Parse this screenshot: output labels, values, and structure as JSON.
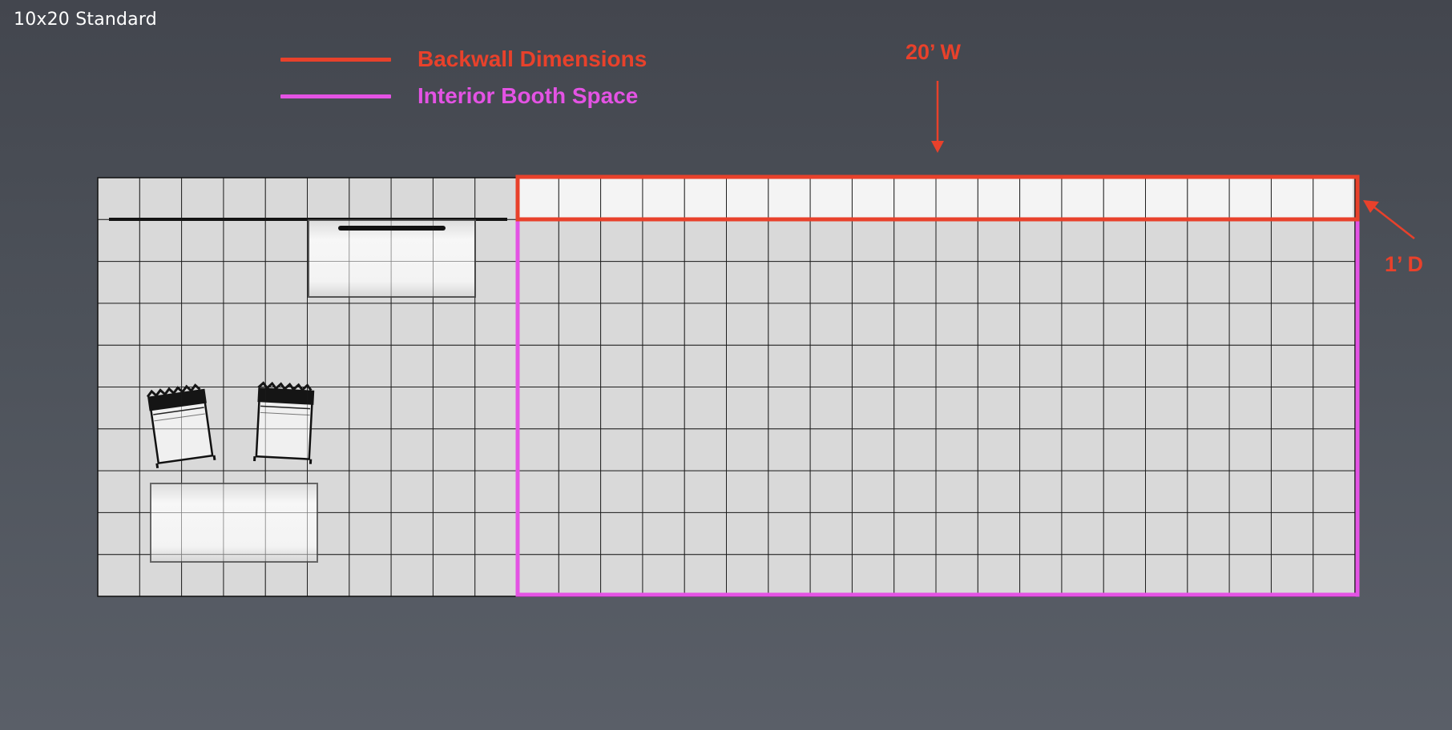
{
  "title": "10x20 Standard",
  "legend": {
    "backwall": {
      "label": "Backwall Dimensions",
      "color": "#e8412b"
    },
    "interior": {
      "label": "Interior Booth Space",
      "color": "#e453e4"
    }
  },
  "dimensions": {
    "width_label": "20’ W",
    "depth_label": "1’ D"
  },
  "grid": {
    "columns": 30,
    "rows": 10
  },
  "colors": {
    "floor": "#d9d9d9",
    "backwall_panel": "#f4f4f4",
    "grid_line": "#1e1e1e",
    "furniture": "#f2f2f2"
  },
  "icons": [
    "chair-icon",
    "table-icon",
    "counter-icon",
    "arrow-down-icon",
    "arrow-diagonal-icon"
  ]
}
